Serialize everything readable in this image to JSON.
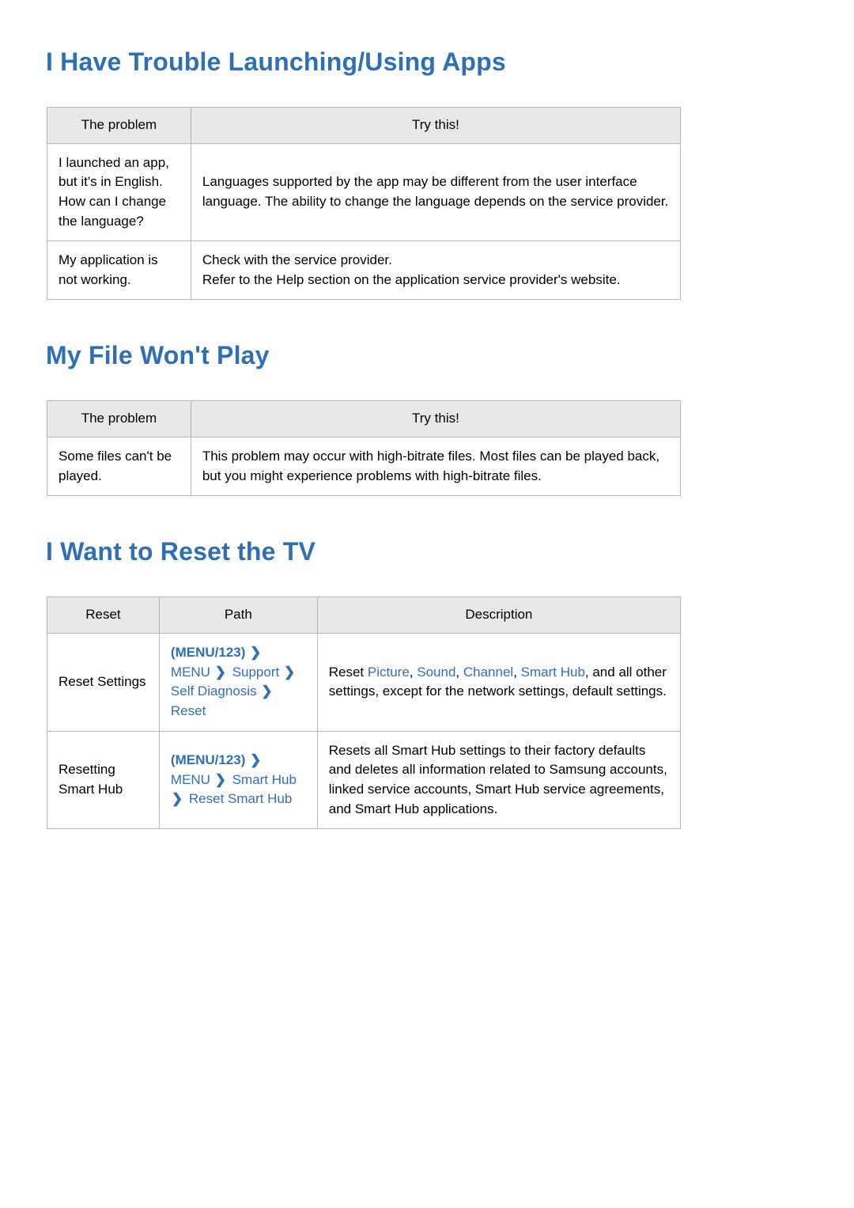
{
  "section1": {
    "title": "I Have Trouble Launching/Using Apps",
    "header_problem": "The problem",
    "header_try": "Try this!",
    "row1_problem": "I launched an app, but it's in English. How can I change the language?",
    "row1_try": "Languages supported by the app may be different from the user interface language. The ability to change the language depends on the service provider.",
    "row2_problem": "My application is not working.",
    "row2_try_line1": "Check with the service provider.",
    "row2_try_line2": "Refer to the Help section on the application service provider's website."
  },
  "section2": {
    "title": "My File Won't Play",
    "header_problem": "The problem",
    "header_try": "Try this!",
    "row1_problem": "Some files can't be played.",
    "row1_try": "This problem may occur with high-bitrate files. Most files can be played back, but you might experience problems with high-bitrate files."
  },
  "section3": {
    "title": "I Want to Reset the TV",
    "header_reset": "Reset",
    "header_path": "Path",
    "header_desc": "Description",
    "row1_reset": "Reset Settings",
    "row1_path_btn": "(MENU/123)",
    "row1_path_s1": "MENU",
    "row1_path_s2": "Support",
    "row1_path_s3": "Self Diagnosis",
    "row1_path_s4": "Reset",
    "row1_desc_p1": "Reset ",
    "row1_desc_hl1": "Picture",
    "row1_desc_c1": ", ",
    "row1_desc_hl2": "Sound",
    "row1_desc_c2": ", ",
    "row1_desc_hl3": "Channel",
    "row1_desc_c3": ", ",
    "row1_desc_hl4": "Smart Hub",
    "row1_desc_p2": ", and all other settings, except for the network settings, default settings.",
    "row2_reset": "Resetting Smart Hub",
    "row2_path_btn": "(MENU/123)",
    "row2_path_s1": "MENU",
    "row2_path_s2": "Smart Hub",
    "row2_path_s3": "Reset Smart Hub",
    "row2_desc": "Resets all Smart Hub settings to their factory defaults and deletes all information related to Samsung accounts, linked service accounts, Smart Hub service agreements, and Smart Hub applications."
  },
  "icons": {
    "chevron": "❯"
  }
}
